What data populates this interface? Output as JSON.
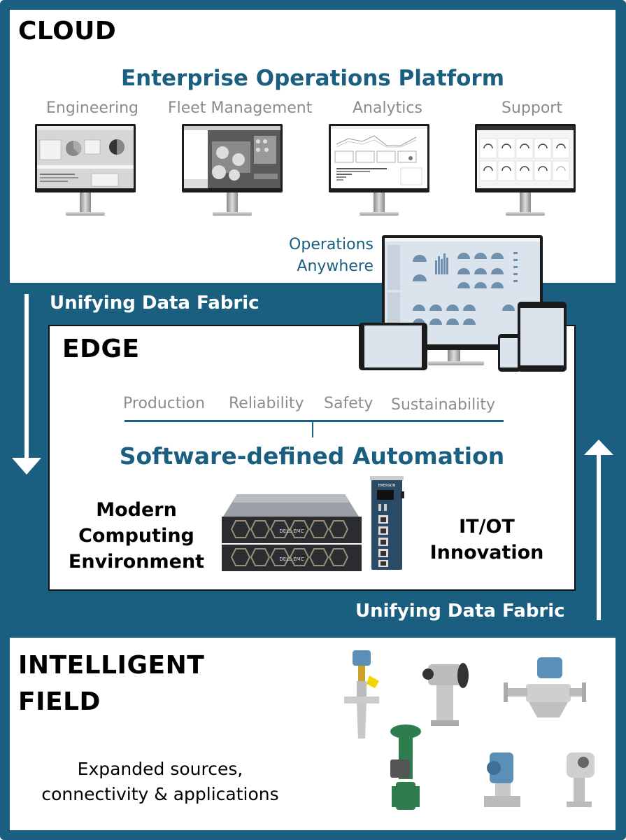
{
  "cloud": {
    "heading": "CLOUD",
    "platform_title": "Enterprise Operations Platform",
    "apps": [
      {
        "label": "Engineering",
        "screen": "engineering-dashboard-screen"
      },
      {
        "label": "Fleet Management",
        "screen": "plant-map-screen"
      },
      {
        "label": "Analytics",
        "screen": "analytics-chart-screen"
      },
      {
        "label": "Support",
        "screen": "support-gauges-screen"
      }
    ],
    "operations_anywhere": [
      "Operations",
      "Anywhere"
    ]
  },
  "fabric": {
    "top_label": "Unifying Data Fabric",
    "bottom_label": "Unifying Data Fabric",
    "down_arrow": "arrow-down-icon",
    "up_arrow": "arrow-up-icon"
  },
  "edge": {
    "heading": "EDGE",
    "pillars": [
      "Production",
      "Reliability",
      "Safety",
      "Sustainability"
    ],
    "automation_title": "Software-defined Automation",
    "left_text": [
      "Modern",
      "Computing",
      "Environment"
    ],
    "right_text": [
      "IT/OT",
      "Innovation"
    ],
    "server_brand": "DELL EMC",
    "controller_brand": "EMERSON"
  },
  "field": {
    "heading": [
      "INTELLIGENT",
      "FIELD"
    ],
    "caption": [
      "Expanded sources,",
      "connectivity & applications"
    ],
    "devices": [
      "radar-level-transmitter",
      "gas-analyzer",
      "coriolis-flow-meter",
      "control-valve",
      "pressure-transmitter",
      "flame-detector"
    ]
  },
  "colors": {
    "brand_blue": "#1a5f80",
    "label_gray": "#8c8c8c",
    "field_device_green": "#2e7d4f",
    "transmitter_blue": "#5a8fb8"
  }
}
